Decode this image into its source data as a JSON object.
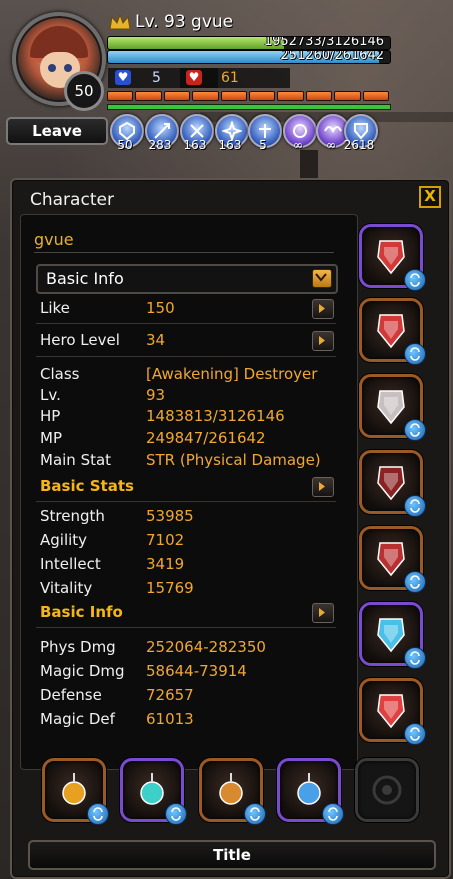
{
  "hud": {
    "portrait_level": "50",
    "level_name": "Lv. 93 gvue",
    "hp_text": "1952733/3126146",
    "hp_fraction": 0.6246,
    "mp_text": "251260/261642",
    "mp_fraction": 0.9603,
    "stat_a_value": "5",
    "stat_b_value": "61",
    "leave_label": "Leave",
    "skills": [
      {
        "icon": "shield-skill-icon",
        "count": "50"
      },
      {
        "icon": "sword-skill-icon",
        "count": "283"
      },
      {
        "icon": "cross-skill-icon",
        "count": "163"
      },
      {
        "icon": "burst-skill-icon",
        "count": "163"
      },
      {
        "icon": "warrior-skill-icon",
        "count": "5"
      },
      {
        "icon": "orb-skill-icon",
        "count": "∞"
      },
      {
        "icon": "wings-skill-icon",
        "count": "∞"
      },
      {
        "icon": "crest-skill-icon",
        "count": "2618"
      }
    ]
  },
  "panel": {
    "title": "Character",
    "close_label": "X",
    "char_name": "gvue",
    "dropdown_selected": "Basic Info",
    "like_label": "Like",
    "like_value": "150",
    "hero_level_label": "Hero Level",
    "hero_level_value": "34",
    "info": [
      {
        "label": "Class",
        "value": "[Awakening] Destroyer"
      },
      {
        "label": "Lv.",
        "value": "93"
      },
      {
        "label": "HP",
        "value": "1483813/3126146"
      },
      {
        "label": "MP",
        "value": "249847/261642"
      },
      {
        "label": "Main Stat",
        "value": "STR (Physical Damage)"
      }
    ],
    "section_basic_stats": "Basic Stats",
    "stats": [
      {
        "label": "Strength",
        "value": "53985"
      },
      {
        "label": "Agility",
        "value": "7102"
      },
      {
        "label": "Intellect",
        "value": "3419"
      },
      {
        "label": "Vitality",
        "value": "15769"
      }
    ],
    "section_basic_info": "Basic Info",
    "combat": [
      {
        "label": "Phys Dmg",
        "value": "252064-282350"
      },
      {
        "label": "Magic Dmg",
        "value": "58644-73914"
      },
      {
        "label": "Defense",
        "value": "72657"
      },
      {
        "label": "Magic Def",
        "value": "61013"
      }
    ],
    "equipment_icons": [
      "helmet-icon",
      "armor-top-icon",
      "armor-bottom-icon",
      "gloves-icon",
      "boots-icon",
      "weapon-icon",
      "offhand-icon"
    ],
    "accessory_icons": [
      "necklace-icon",
      "earring-icon",
      "ring-icon",
      "ring-icon-2",
      "empty-slot-icon"
    ],
    "title_label": "Title",
    "colors": {
      "accent_gold": "#f5b618",
      "value_orange": "#f0a832",
      "hp_green": "#5fa02c",
      "mp_blue": "#2f8cc8"
    }
  }
}
